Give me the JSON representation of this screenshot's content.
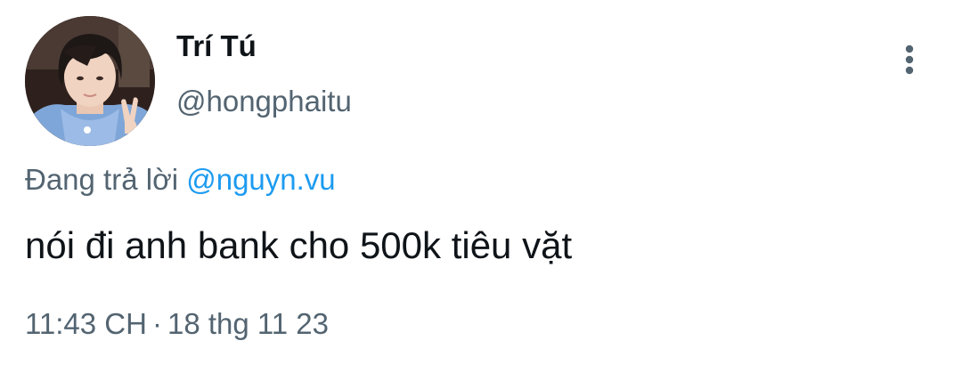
{
  "user": {
    "display_name": "Trí Tú",
    "handle": "@hongphaitu"
  },
  "reply": {
    "prefix": "Đang trả lời",
    "handle": "@nguyn.vu"
  },
  "tweet": {
    "text": "nói đi anh bank cho 500k tiêu vặt",
    "time": "11:43 CH",
    "separator": "·",
    "date": "18 thg 11 23"
  },
  "icons": {
    "more": "more-vertical-icon",
    "avatar": "avatar-photo"
  },
  "colors": {
    "name": "#0f1419",
    "secondary": "#536471",
    "link": "#1d9bf0"
  }
}
